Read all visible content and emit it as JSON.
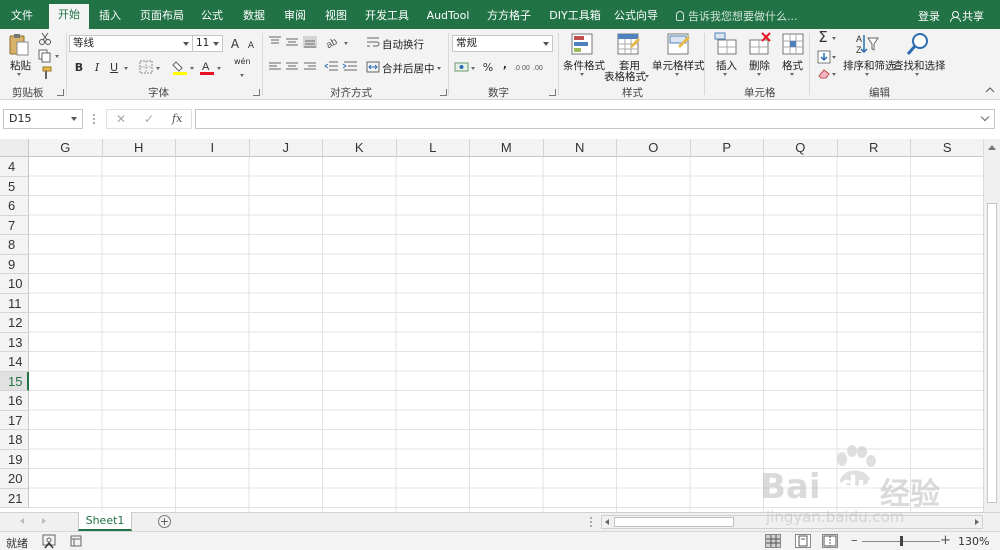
{
  "tabs": [
    {
      "label": "文件",
      "active": false
    },
    {
      "label": "开始",
      "active": true
    },
    {
      "label": "插入",
      "active": false
    },
    {
      "label": "页面布局",
      "active": false
    },
    {
      "label": "公式",
      "active": false
    },
    {
      "label": "数据",
      "active": false
    },
    {
      "label": "审阅",
      "active": false
    },
    {
      "label": "视图",
      "active": false
    },
    {
      "label": "开发工具",
      "active": false
    },
    {
      "label": "AudTool",
      "active": false
    },
    {
      "label": "方方格子",
      "active": false
    },
    {
      "label": "DIY工具箱",
      "active": false
    },
    {
      "label": "公式向导",
      "active": false
    }
  ],
  "tell_me": "告诉我您想要做什么...",
  "login": "登录",
  "share": "共享",
  "ribbon": {
    "clipboard": {
      "paste": "粘贴",
      "group": "剪贴板"
    },
    "font": {
      "name": "等线",
      "size": "11",
      "bold": "B",
      "italic": "I",
      "underline": "U",
      "group": "字体",
      "grow": "A",
      "shrink": "A",
      "wen": "wén"
    },
    "alignment": {
      "wrap": "自动换行",
      "merge": "合并后居中",
      "group": "对齐方式"
    },
    "number": {
      "format": "常规",
      "percent": "%",
      "comma": ",",
      "group": "数字"
    },
    "styles": {
      "conditional": "条件格式",
      "table1": "套用",
      "table2": "表格格式",
      "cell_styles": "单元格样式",
      "group": "样式"
    },
    "cells": {
      "insert": "插入",
      "delete": "删除",
      "format": "格式",
      "group": "单元格"
    },
    "editing": {
      "sort": "排序和筛选",
      "find": "查找和选择",
      "group": "编辑"
    }
  },
  "formula_bar": {
    "name_box": "D15",
    "cancel": "✕",
    "enter": "✓",
    "fx": "fx",
    "value": ""
  },
  "columns": [
    "G",
    "H",
    "I",
    "J",
    "K",
    "L",
    "M",
    "N",
    "O",
    "P",
    "Q",
    "R",
    "S"
  ],
  "rows": [
    "4",
    "5",
    "6",
    "7",
    "8",
    "9",
    "10",
    "11",
    "12",
    "13",
    "14",
    "15",
    "16",
    "17",
    "18",
    "19",
    "20",
    "21"
  ],
  "selected_row": "15",
  "sheets": [
    {
      "name": "Sheet1",
      "active": true
    }
  ],
  "status": {
    "ready": "就绪",
    "zoom": "130%"
  },
  "watermark": {
    "brand": "Bai",
    "brand2": "du",
    "cn": "经验",
    "url": "jingyan.baidu.com"
  },
  "colors": {
    "accent": "#217346"
  }
}
